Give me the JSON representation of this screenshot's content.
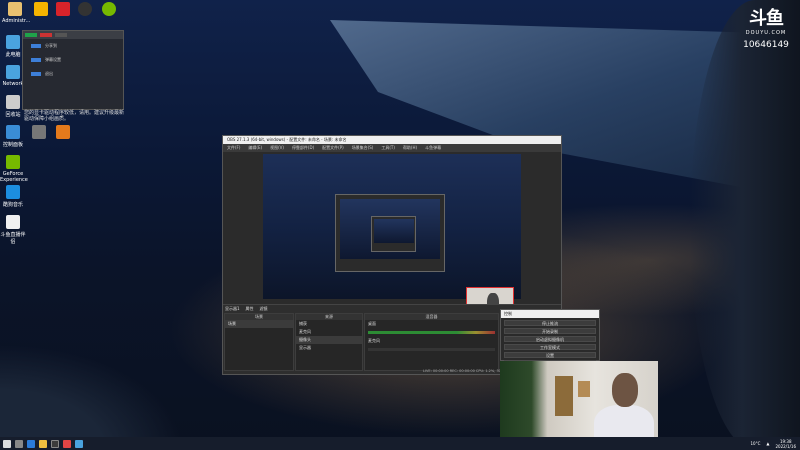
{
  "desktop": {
    "icons": [
      {
        "label": "Administr..."
      },
      {
        "label": "此电脑"
      },
      {
        "label": "Network"
      },
      {
        "label": "回收站"
      },
      {
        "label": "控制面板"
      },
      {
        "label": "GeForce Experience"
      },
      {
        "label": "酷狗音乐"
      },
      {
        "label": "斗鱼直播伴侣"
      },
      {
        "label": "腾讯QQ"
      },
      {
        "label": "Steam"
      },
      {
        "label": "OBS"
      }
    ],
    "notice_text": "您的显卡驱动程序较低，请用。建议升级最新驱动保障小组画质。",
    "side_caption": "蓝光中公开 开元地址"
  },
  "tray_popup": {
    "rows": [
      "分享到",
      "弹幕设置",
      "退出"
    ]
  },
  "logo": {
    "mark": "斗鱼",
    "domain": "DOUYU.COM",
    "room": "10646149"
  },
  "obs": {
    "title": "OBS 27.1.3 (64-bit, windows) - 配置文件: 未命名 - 场景: 未命名",
    "menus": [
      "文件(F)",
      "编辑(E)",
      "视图(V)",
      "停靠部件(D)",
      "配置文件(P)",
      "场景集合(S)",
      "工具(T)",
      "帮助(H)",
      "斗鱼弹幕"
    ],
    "toolbar_label": "显示器1",
    "filter_btn": "属性",
    "filter_btn2": "滤镜",
    "scene_header": "场景",
    "scene_item": "场景",
    "source_header": "来源",
    "sources": [
      "捕获",
      "麦克风",
      "摄像头",
      "显示器"
    ],
    "mixer_header": "混音器",
    "mixer_items": [
      "桌面",
      "麦克风"
    ],
    "status_text": "LIVE: 00:00:00  REC: 00:00:00  CPU: 1.2%, 30.00 fps"
  },
  "obs_controls": {
    "title": "控制",
    "buttons": [
      "停止推流",
      "开始录制",
      "启动虚拟摄像机",
      "工作室模式",
      "设置",
      "退出"
    ]
  },
  "taskbar": {
    "temperature": "10°C",
    "time": "19:38",
    "date": "2022/1/16"
  }
}
